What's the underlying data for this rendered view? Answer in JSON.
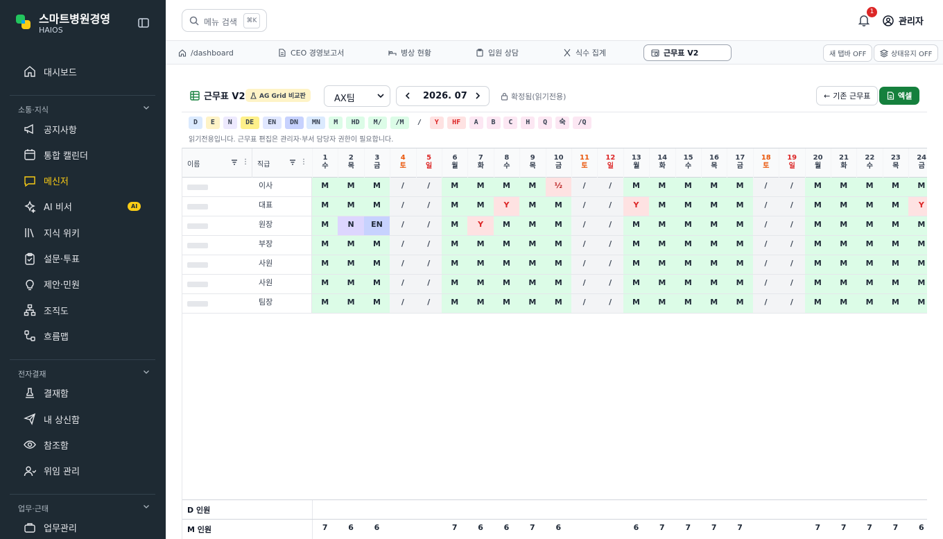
{
  "brand": {
    "title": "스마트병원경영",
    "subtitle": "HAIOS"
  },
  "sidebar": {
    "top_items": [
      {
        "label": "대시보드",
        "icon": "home-icon"
      }
    ],
    "sections": [
      {
        "title": "소통·지식",
        "items": [
          {
            "label": "공지사항",
            "icon": "megaphone-icon"
          },
          {
            "label": "통합 캘린더",
            "icon": "calendar-icon"
          },
          {
            "label": "메신저",
            "icon": "message-icon",
            "active": true
          },
          {
            "label": "AI 비서",
            "icon": "sparkle-icon",
            "badge": "AI"
          },
          {
            "label": "지식 위키",
            "icon": "library-icon"
          },
          {
            "label": "설문·투표",
            "icon": "clipboard-icon"
          },
          {
            "label": "제안·민원",
            "icon": "lightbulb-icon"
          },
          {
            "label": "조직도",
            "icon": "org-chart-icon"
          },
          {
            "label": "흐름맵",
            "icon": "flow-map-icon"
          }
        ]
      },
      {
        "title": "전자결재",
        "items": [
          {
            "label": "결재함",
            "icon": "stamp-icon"
          },
          {
            "label": "내 상신함",
            "icon": "send-icon"
          },
          {
            "label": "참조함",
            "icon": "eye-icon"
          },
          {
            "label": "위임 관리",
            "icon": "user-delegate-icon"
          }
        ]
      },
      {
        "title": "업무·근태",
        "items": [
          {
            "label": "업무관리",
            "icon": "briefcase-icon"
          }
        ]
      }
    ],
    "accent": "#facc15"
  },
  "topbar": {
    "search_placeholder": "메뉴 검색",
    "shortcut": "⌘K",
    "notification_count": "1",
    "user_name": "관리자"
  },
  "tabs": [
    {
      "label": "/dashboard",
      "icon": "home-icon"
    },
    {
      "label": "CEO 경영보고서",
      "icon": "document-icon"
    },
    {
      "label": "병상 현황",
      "icon": "bed-icon"
    },
    {
      "label": "입원 상담",
      "icon": "clipboard-icon"
    },
    {
      "label": "식수 집계",
      "icon": "utensils-icon"
    },
    {
      "label": "근무표 V2",
      "icon": "calendar-clock-icon",
      "active": true
    }
  ],
  "tab_toggles": {
    "new_tab": "새 탭바 OFF",
    "keep_state": "상태유지 OFF"
  },
  "page": {
    "title": "근무표 V2",
    "badge": "AG Grid 비교판",
    "team": "AX팀",
    "month": "2026. 07",
    "lock_status": "확정됨(읽기전용)",
    "back_button": "기존 근무표",
    "excel_button": "엑셀",
    "readonly_note": "읽기전용입니다. 근무표 편집은 관리자·부서 담당자 권한이 필요합니다."
  },
  "legend": [
    {
      "code": "D",
      "bg": "#dbeafe"
    },
    {
      "code": "E",
      "bg": "#fef3c7"
    },
    {
      "code": "N",
      "bg": "#ede9fe"
    },
    {
      "code": "DE",
      "bg": "#fef08a"
    },
    {
      "code": "EN",
      "bg": "#e0e7ff"
    },
    {
      "code": "DN",
      "bg": "#c7d2fe"
    },
    {
      "code": "MN",
      "bg": "#dbeafe"
    },
    {
      "code": "M",
      "bg": "#dcfce7"
    },
    {
      "code": "HD",
      "bg": "#dcfce7"
    },
    {
      "code": "M/",
      "bg": "#dcfce7"
    },
    {
      "code": "/M",
      "bg": "#dcfce7"
    },
    {
      "code": "/",
      "bg": "#ffffff"
    },
    {
      "code": "Y",
      "bg": "#fee2e2"
    },
    {
      "code": "HF",
      "bg": "#fee2e2"
    },
    {
      "code": "A",
      "bg": "#fce7f3"
    },
    {
      "code": "B",
      "bg": "#fce7f3"
    },
    {
      "code": "C",
      "bg": "#fce7f3"
    },
    {
      "code": "H",
      "bg": "#fce7f3"
    },
    {
      "code": "Q",
      "bg": "#fce7f3"
    },
    {
      "code": "숙",
      "bg": "#fce7f3"
    },
    {
      "code": "/Q",
      "bg": "#fce7f3"
    }
  ],
  "columns": {
    "name": "이름",
    "rank": "직급"
  },
  "days": [
    {
      "num": "1",
      "wd": "수"
    },
    {
      "num": "2",
      "wd": "목"
    },
    {
      "num": "3",
      "wd": "금"
    },
    {
      "num": "4",
      "wd": "토"
    },
    {
      "num": "5",
      "wd": "일"
    },
    {
      "num": "6",
      "wd": "월"
    },
    {
      "num": "7",
      "wd": "화"
    },
    {
      "num": "8",
      "wd": "수"
    },
    {
      "num": "9",
      "wd": "목"
    },
    {
      "num": "10",
      "wd": "금"
    },
    {
      "num": "11",
      "wd": "토"
    },
    {
      "num": "12",
      "wd": "일"
    },
    {
      "num": "13",
      "wd": "월"
    },
    {
      "num": "14",
      "wd": "화"
    },
    {
      "num": "15",
      "wd": "수"
    },
    {
      "num": "16",
      "wd": "목"
    },
    {
      "num": "17",
      "wd": "금"
    },
    {
      "num": "18",
      "wd": "토"
    },
    {
      "num": "19",
      "wd": "일"
    },
    {
      "num": "20",
      "wd": "월"
    },
    {
      "num": "21",
      "wd": "화"
    },
    {
      "num": "22",
      "wd": "수"
    },
    {
      "num": "23",
      "wd": "목"
    },
    {
      "num": "24",
      "wd": "금"
    }
  ],
  "rows": [
    {
      "rank": "이사",
      "shifts": [
        "M",
        "M",
        "M",
        "/",
        "/",
        "M",
        "M",
        "M",
        "M",
        "½",
        "/",
        "/",
        "M",
        "M",
        "M",
        "M",
        "M",
        "/",
        "/",
        "M",
        "M",
        "M",
        "M",
        "M"
      ]
    },
    {
      "rank": "대표",
      "shifts": [
        "M",
        "M",
        "M",
        "/",
        "/",
        "M",
        "M",
        "Y",
        "M",
        "M",
        "/",
        "/",
        "Y",
        "M",
        "M",
        "M",
        "M",
        "/",
        "/",
        "M",
        "M",
        "M",
        "M",
        "Y"
      ]
    },
    {
      "rank": "원장",
      "shifts": [
        "M",
        "N",
        "EN",
        "/",
        "/",
        "M",
        "Y",
        "M",
        "M",
        "M",
        "/",
        "/",
        "M",
        "M",
        "M",
        "M",
        "M",
        "/",
        "/",
        "M",
        "M",
        "M",
        "M",
        "M"
      ]
    },
    {
      "rank": "부장",
      "shifts": [
        "M",
        "M",
        "M",
        "/",
        "/",
        "M",
        "M",
        "M",
        "M",
        "M",
        "/",
        "/",
        "M",
        "M",
        "M",
        "M",
        "M",
        "/",
        "/",
        "M",
        "M",
        "M",
        "M",
        "M"
      ]
    },
    {
      "rank": "사원",
      "shifts": [
        "M",
        "M",
        "M",
        "/",
        "/",
        "M",
        "M",
        "M",
        "M",
        "M",
        "/",
        "/",
        "M",
        "M",
        "M",
        "M",
        "M",
        "/",
        "/",
        "M",
        "M",
        "M",
        "M",
        "M"
      ]
    },
    {
      "rank": "사원",
      "shifts": [
        "M",
        "M",
        "M",
        "/",
        "/",
        "M",
        "M",
        "M",
        "M",
        "M",
        "/",
        "/",
        "M",
        "M",
        "M",
        "M",
        "M",
        "/",
        "/",
        "M",
        "M",
        "M",
        "M",
        "M"
      ]
    },
    {
      "rank": "팀장",
      "shifts": [
        "M",
        "M",
        "M",
        "/",
        "/",
        "M",
        "M",
        "M",
        "M",
        "M",
        "/",
        "/",
        "M",
        "M",
        "M",
        "M",
        "M",
        "/",
        "/",
        "M",
        "M",
        "M",
        "M",
        "M"
      ]
    }
  ],
  "footer": [
    {
      "label": "D 인원",
      "values": [
        "",
        "",
        "",
        "",
        "",
        "",
        "",
        "",
        "",
        "",
        "",
        "",
        "",
        "",
        "",
        "",
        "",
        "",
        "",
        "",
        "",
        "",
        "",
        ""
      ]
    },
    {
      "label": "M 인원",
      "values": [
        "7",
        "6",
        "6",
        "",
        "",
        "7",
        "6",
        "6",
        "7",
        "6",
        "",
        "",
        "6",
        "7",
        "7",
        "7",
        "7",
        "",
        "",
        "7",
        "7",
        "7",
        "7",
        "6"
      ]
    }
  ]
}
